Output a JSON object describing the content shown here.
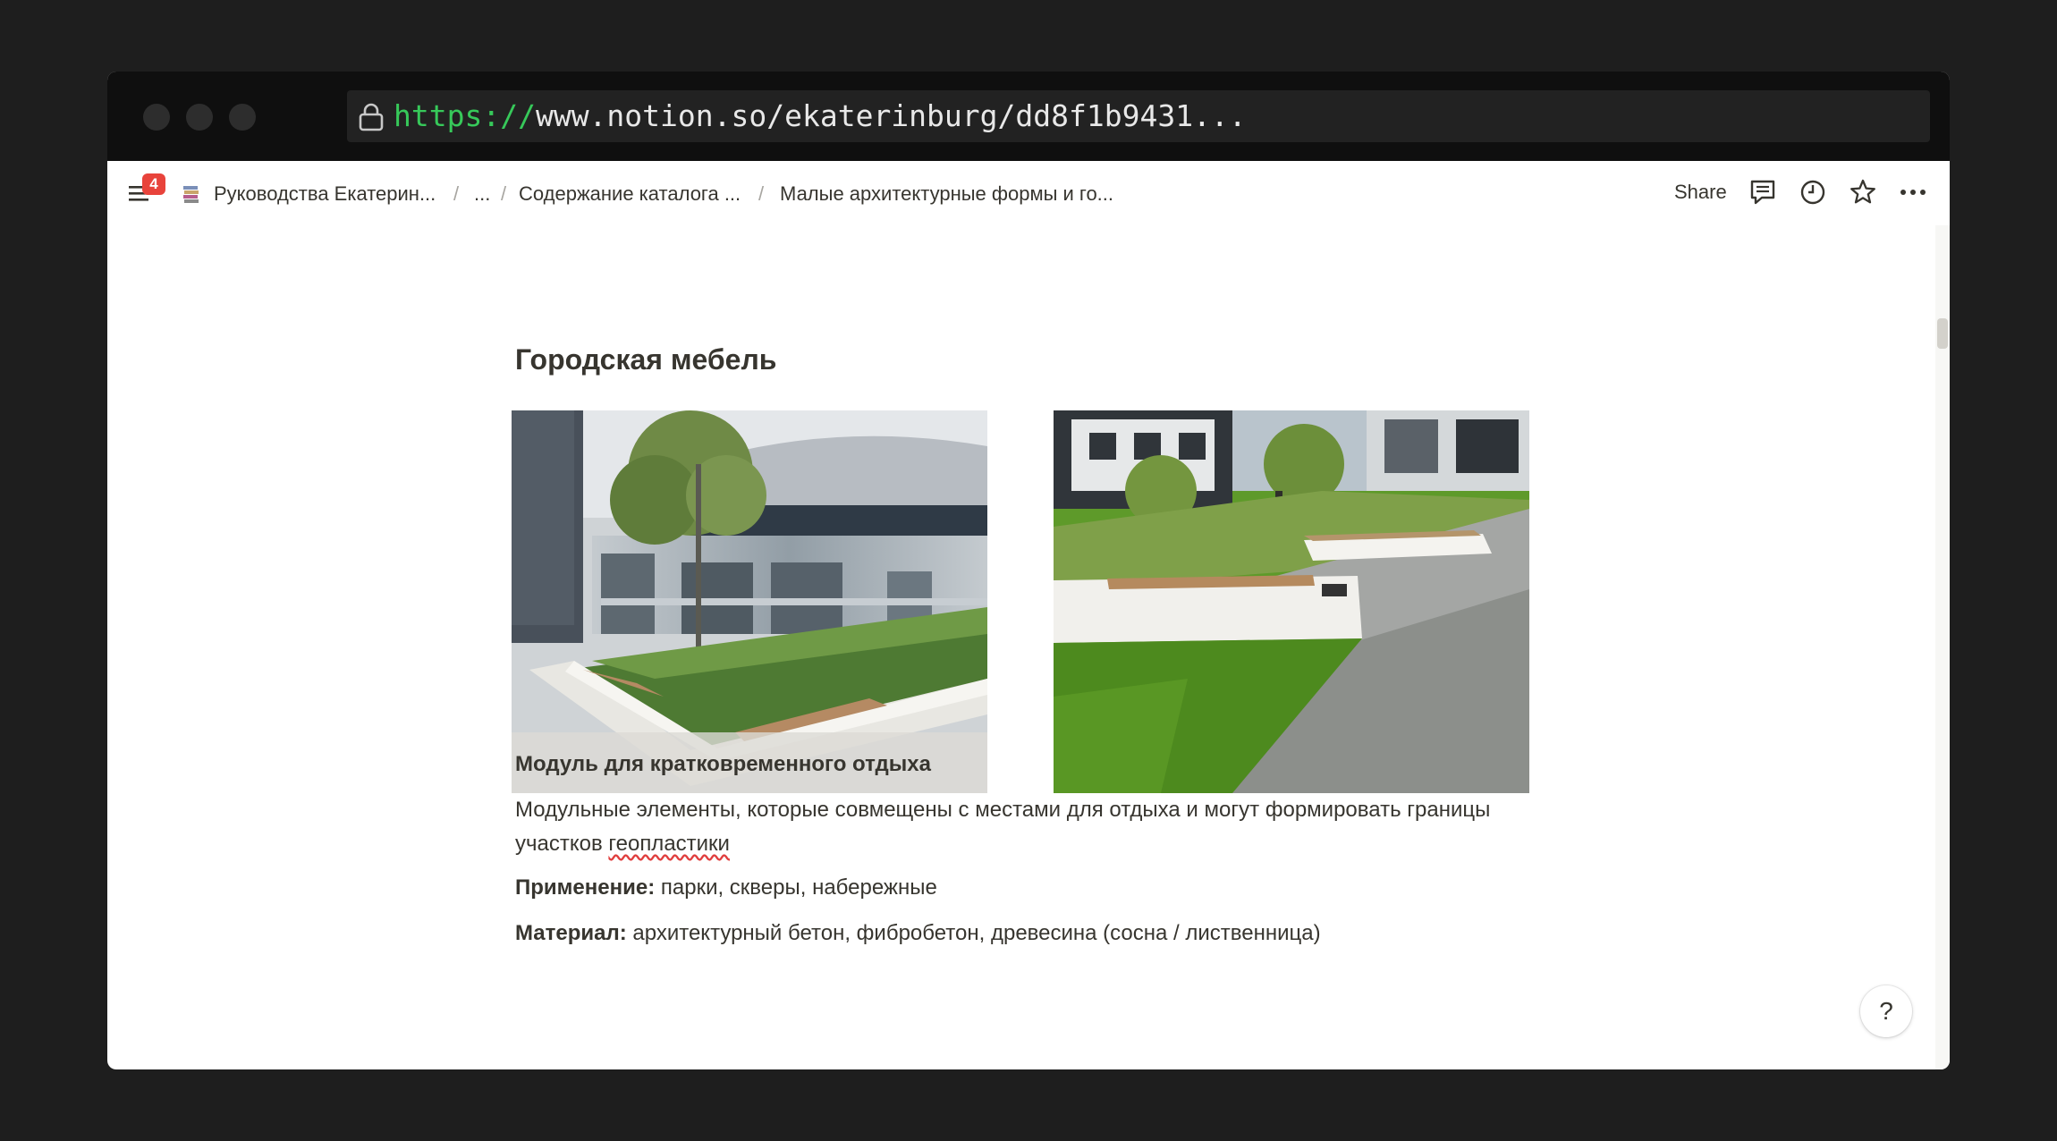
{
  "browser": {
    "url_scheme": "https://",
    "url_rest": "www.notion.so/ekaterinburg/dd8f1b9431..."
  },
  "topbar": {
    "notification_count": "4",
    "breadcrumbs": [
      "Руководства Екатерин...",
      "...",
      "Содержание каталога ...",
      "Малые архитектурные формы и го..."
    ],
    "separator": "/",
    "share_label": "Share",
    "icons": [
      "menu-icon",
      "page-icon",
      "comment-icon",
      "clock-icon",
      "star-icon",
      "more-icon"
    ]
  },
  "page": {
    "heading": "Городская мебель",
    "section": {
      "title": "Модуль для кратковременного отдыха",
      "description_main": "Модульные элементы, которые совмещены с местами для отдыха и могут формировать границы участков ",
      "description_link": "геопластики",
      "application_label": "Применение:",
      "application_value": " парки, скверы, набережные",
      "material_label": "Материал:",
      "material_value": " архитектурный бетон, фибробетон, древесина (сосна / лиственница)"
    }
  },
  "help_label": "?",
  "colors": {
    "desktop_bg": "#1e1e1e",
    "titlebar_bg": "#0f0f0f",
    "url_scheme": "#37c95a",
    "text": "#37352f",
    "badge": "#e8433b"
  }
}
